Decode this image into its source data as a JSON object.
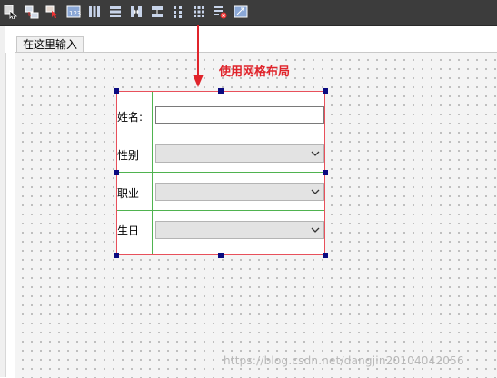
{
  "toolbar": {
    "buttons": [
      {
        "name": "edit-widgets-icon"
      },
      {
        "name": "edit-signals-slots-icon"
      },
      {
        "name": "edit-buddies-icon"
      },
      {
        "name": "edit-tab-order-icon"
      },
      {
        "name": "layout-horizontal-icon"
      },
      {
        "name": "layout-vertical-icon"
      },
      {
        "name": "layout-horizontal-splitter-icon"
      },
      {
        "name": "layout-vertical-splitter-icon"
      },
      {
        "name": "layout-form-icon"
      },
      {
        "name": "layout-grid-icon"
      },
      {
        "name": "break-layout-icon"
      },
      {
        "name": "adjust-size-icon"
      }
    ]
  },
  "tab": {
    "label": "在这里输入"
  },
  "annotation": {
    "text": "使用网格布局",
    "color": "#e0242b"
  },
  "form": {
    "name_label": "姓名:",
    "name_value": "",
    "gender_label": "性别",
    "gender_value": "",
    "job_label": "职业",
    "job_value": "",
    "birthday_label": "生日",
    "birthday_value": ""
  },
  "colors": {
    "layout_border": "#e8505b",
    "grid_lines": "#4fb34f",
    "handles": "#0a0a80"
  },
  "watermark": "https://blog.csdn.net/dangjin20104042056"
}
